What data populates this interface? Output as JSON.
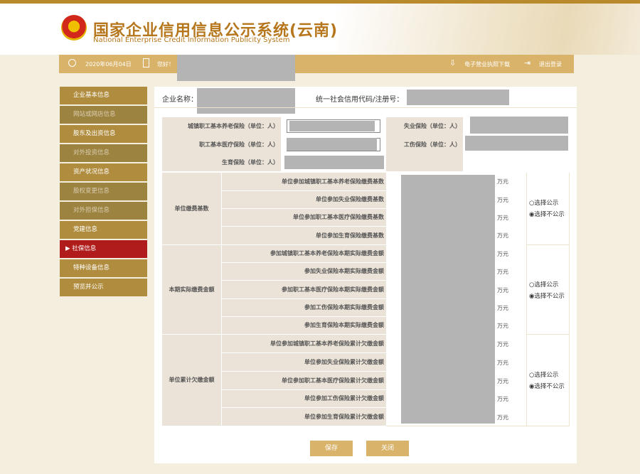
{
  "header": {
    "title_cn": "国家企业信用信息公示系统(云南)",
    "title_en": "National Enterprise Credit Information Publicity System"
  },
  "infobar": {
    "date": "2020年06月04日",
    "greeting": "您好！",
    "download_license": "电子营业执照下载",
    "logout": "退出登录"
  },
  "sidebar": {
    "items": [
      {
        "label": "企业基本信息"
      },
      {
        "label": "网站或网店信息"
      },
      {
        "label": "股东及出资信息"
      },
      {
        "label": "对外投资信息"
      },
      {
        "label": "资产状况信息"
      },
      {
        "label": "股权变更信息"
      },
      {
        "label": "对外担保信息"
      },
      {
        "label": "党建信息"
      },
      {
        "label": "社保信息"
      },
      {
        "label": "特种设备信息"
      },
      {
        "label": "预览并公示"
      }
    ]
  },
  "company": {
    "name_label": "企业名称：",
    "code_label": "统一社会信用代码/注册号："
  },
  "insurance": {
    "pension_label": "城镇职工基本养老保险（单位：人）",
    "unemployment_label": "失业保险（单位：人）",
    "medical_label": "职工基本医疗保险（单位：人）",
    "injury_label": "工伤保险（单位：人）",
    "maternity_label": "生育保险（单位：人）"
  },
  "groups": [
    {
      "label": "单位缴费基数",
      "rows": [
        "单位参加城镇职工基本养老保险缴费基数",
        "单位参加失业保险缴费基数",
        "单位参加职工基本医疗保险缴费基数",
        "单位参加生育保险缴费基数"
      ],
      "publish": "选择公示",
      "unpublish": "选择不公示"
    },
    {
      "label": "本期实际缴费金额",
      "rows": [
        "参加城镇职工基本养老保险本期实际缴费金额",
        "参加失业保险本期实际缴费金额",
        "参加职工基本医疗保险本期实际缴费金额",
        "参加工伤保险本期实际缴费金额",
        "参加生育保险本期实际缴费金额"
      ],
      "publish": "选择公示",
      "unpublish": "选择不公示"
    },
    {
      "label": "单位累计欠缴金额",
      "rows": [
        "单位参加城镇职工基本养老保险累计欠缴金额",
        "单位参加失业保险累计欠缴金额",
        "单位参加职工基本医疗保险累计欠缴金额",
        "单位参加工伤保险累计欠缴金额",
        "单位参加生育保险累计欠缴金额"
      ],
      "publish": "选择公示",
      "unpublish": "选择不公示"
    }
  ],
  "unit": "万元",
  "buttons": {
    "save": "保存",
    "close": "关闭"
  }
}
